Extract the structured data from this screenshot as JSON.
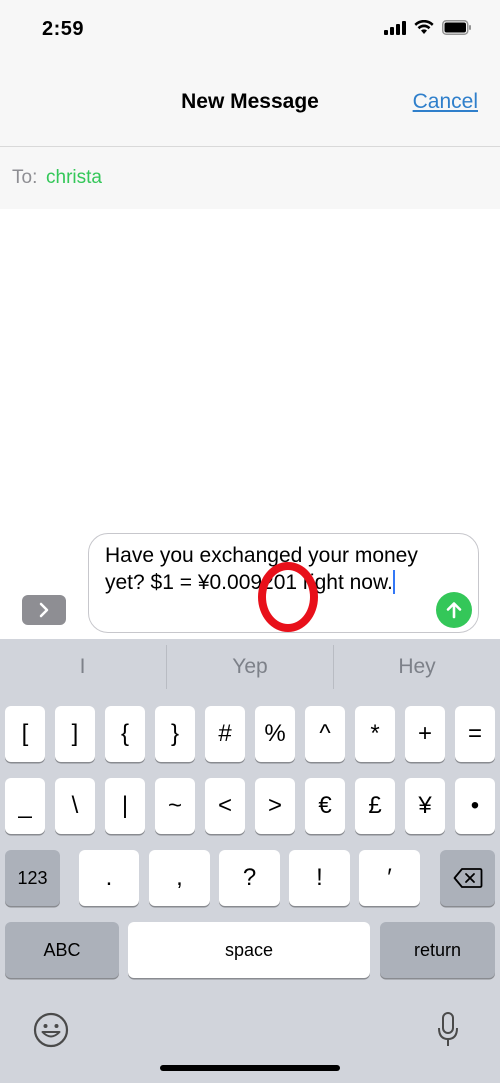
{
  "status_bar": {
    "time": "2:59"
  },
  "nav": {
    "title": "New Message",
    "cancel_label": "Cancel"
  },
  "recipient": {
    "label": "To:",
    "value": "christa"
  },
  "compose": {
    "text": "Have you exchanged your money yet? $1 = ¥0.009201 right now."
  },
  "predictions": [
    "I",
    "Yep",
    "Hey"
  ],
  "keyboard": {
    "row1": [
      "[",
      "]",
      "{",
      "}",
      "#",
      "%",
      "^",
      "*",
      "+",
      "="
    ],
    "row2": [
      "_",
      "\\",
      "|",
      "~",
      "<",
      ">",
      "€",
      "£",
      "¥",
      "•"
    ],
    "row3": [
      ".",
      ",",
      "?",
      "!",
      "′"
    ],
    "mode_123": "123",
    "abc": "ABC",
    "space": "space",
    "return": "return"
  },
  "colors": {
    "accent_green": "#34c759",
    "link_blue": "#2f7fcb",
    "annotation_red": "#e8101a",
    "keyboard_bg": "#d1d4db"
  },
  "icons": {
    "expand": "chevron-right-icon",
    "send": "arrow-up-icon",
    "delete": "backspace-icon",
    "emoji": "emoji-icon",
    "mic": "microphone-icon"
  }
}
